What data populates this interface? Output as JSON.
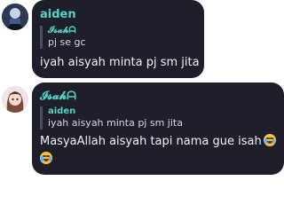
{
  "messages": [
    {
      "author": "aiden",
      "reply": {
        "author": "𝓘𝓼𝓪𝓱ᗩ",
        "text": "pj se gc"
      },
      "text": "iyah aisyah minta pj sm jita"
    },
    {
      "author": "𝓘𝓼𝓪𝓱ᗩ",
      "reply": {
        "author": "aiden",
        "text": "iyah aisyah minta pj sm jita"
      },
      "text": "MasyaAllah aisyah tapi nama gue isah",
      "emoji": "loudly-crying-face"
    }
  ],
  "colors": {
    "bubble": "#1f1f2b",
    "author": "#54d2c4",
    "text": "#f1f2f6"
  }
}
